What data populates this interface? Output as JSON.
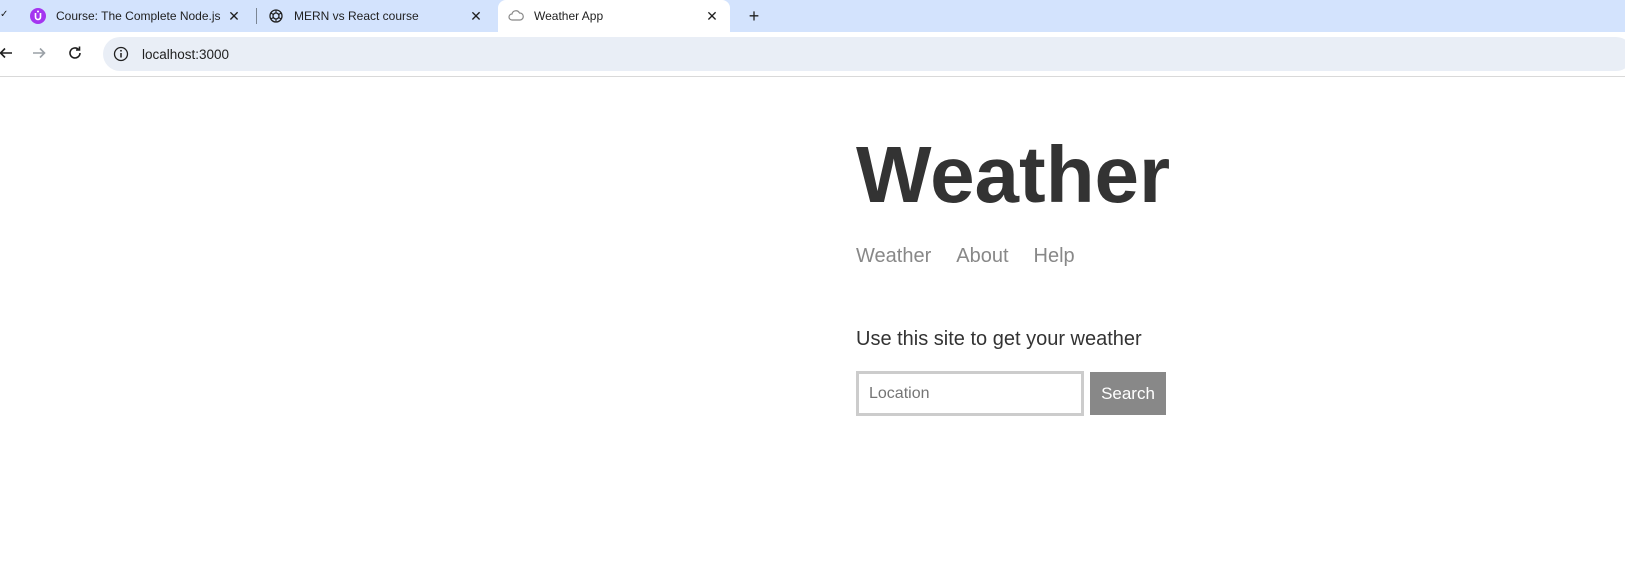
{
  "browser": {
    "tabs": [
      {
        "title": "Course: The Complete Node.js D",
        "icon": "udemy-icon"
      },
      {
        "title": "MERN vs React course",
        "icon": "chatgpt-icon"
      },
      {
        "title": "Weather App",
        "icon": "cloud-icon",
        "active": true
      }
    ],
    "url": "localhost:3000",
    "colors": {
      "tabstrip": "#d3e3fd",
      "omnibox": "#e9eef6",
      "udemy_purple": "#a435f0"
    }
  },
  "page": {
    "heading": "Weather",
    "nav": {
      "weather": "Weather",
      "about": "About",
      "help": "Help"
    },
    "subtitle": "Use this site to get your weather",
    "form": {
      "placeholder": "Location",
      "value": "",
      "button": "Search"
    },
    "colors": {
      "text": "#333333",
      "link": "#888888",
      "button_bg": "#888888",
      "input_border": "#cccccc"
    }
  }
}
